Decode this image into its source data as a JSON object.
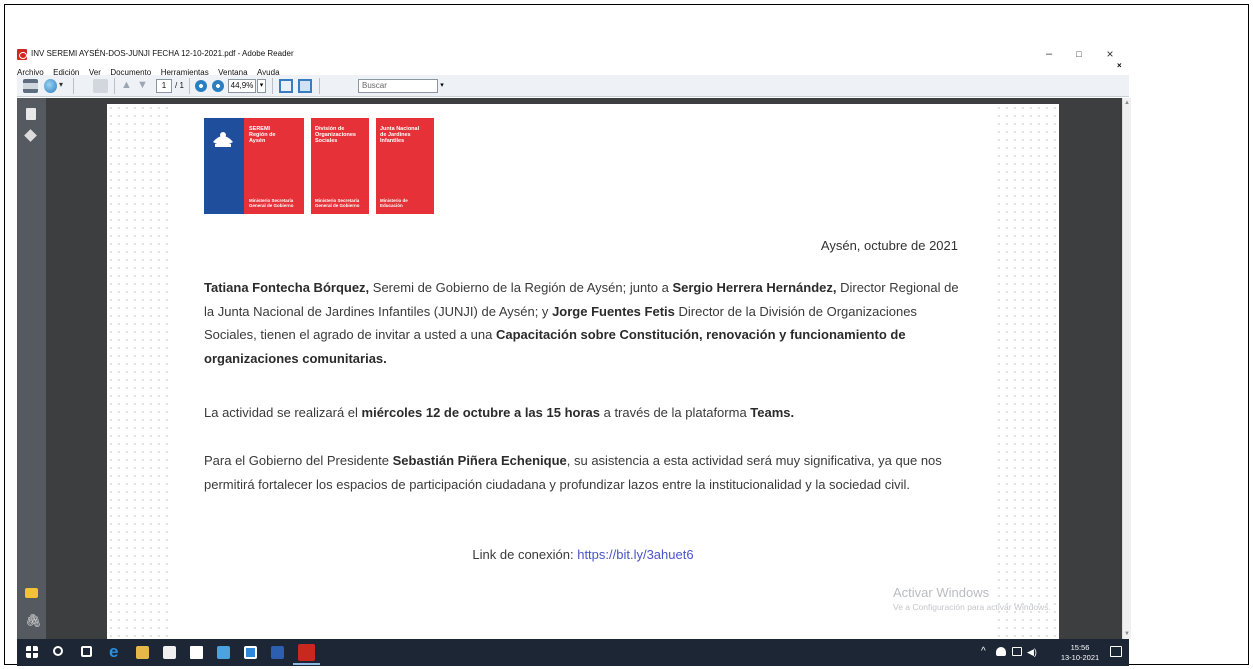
{
  "window": {
    "title": "INV SEREMI AYSÉN-DOS-JUNJI FECHA 12-10-2021.pdf - Adobe Reader",
    "minimize": "–",
    "maximize": "□",
    "close": "×",
    "doc_close": "×"
  },
  "menu": {
    "items": [
      "Archivo",
      "Edición",
      "Ver",
      "Documento",
      "Herramientas",
      "Ventana",
      "Ayuda"
    ]
  },
  "toolbar": {
    "page_current": "1",
    "page_total": "/ 1",
    "zoom": "44,9%",
    "search_placeholder": "Buscar"
  },
  "logos": {
    "seremi": {
      "title": "SEREMI\nRegión de\nAysén",
      "sub": "Ministerio Secretaría\nGeneral de Gobierno"
    },
    "division": {
      "title": "División de\nOrganizaciones\nSociales",
      "sub": "Ministerio Secretaría\nGeneral de Gobierno"
    },
    "junji": {
      "title": "Junta Nacional\nde Jardines\nInfantiles",
      "sub": "Ministerio de\nEducación"
    }
  },
  "document": {
    "date_line": "Aysén, octubre de 2021",
    "p1": {
      "name1": "Tatiana Fontecha Bórquez,",
      "t1": " Seremi de Gobierno de la Región de Aysén; junto a ",
      "name2": "Sergio Herrera Hernández,",
      "t2": " Director Regional de la Junta Nacional de Jardines Infantiles (JUNJI) de Aysén; y ",
      "name3": "Jorge Fuentes Fetis",
      "t3": " Director de la División de Organizaciones Sociales, tienen el agrado de invitar a usted a una ",
      "topic": "Capacitación sobre Constitución, renovación y funcionamiento de organizaciones comunitarias."
    },
    "p2": {
      "t1": "La actividad se realizará el ",
      "when": "miércoles 12 de octubre a las 15 horas",
      "t2": " a través de la plataforma ",
      "platform": "Teams."
    },
    "p3": {
      "t1": "Para el Gobierno del Presidente ",
      "president": "Sebastián Piñera Echenique",
      "t2": ", su asistencia a esta actividad será muy significativa, ya que nos permitirá fortalecer los espacios de participación ciudadana y profundizar lazos entre la institucionalidad y la sociedad civil."
    },
    "link_label": "Link de conexión: ",
    "link_url": "https://bit.ly/3ahuet6"
  },
  "watermark": {
    "title": "Activar Windows",
    "sub": "Ve a Configuración para activar Windows."
  },
  "taskbar": {
    "time": "15:56",
    "date": "13-10-2021"
  }
}
